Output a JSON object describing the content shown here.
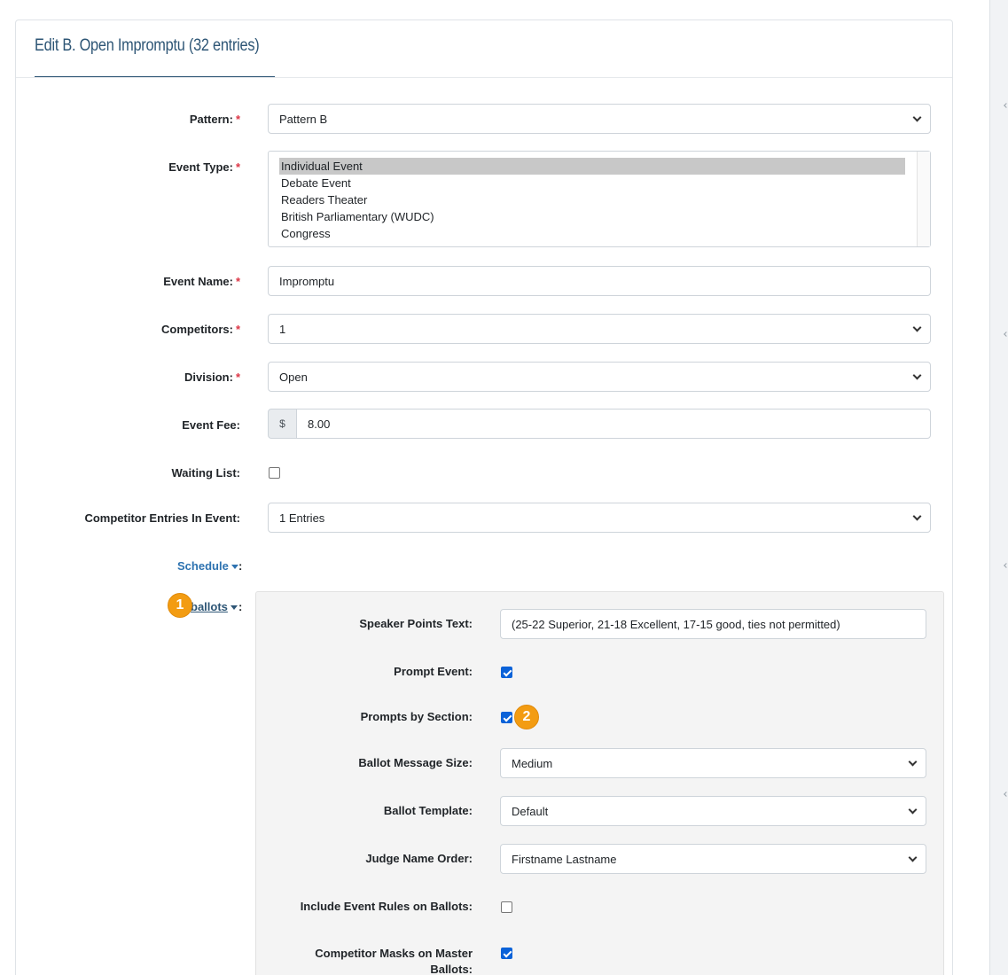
{
  "card": {
    "title": "Edit B. Open Impromptu (32 entries)"
  },
  "required_mark": "*",
  "fields": {
    "pattern": {
      "label": "Pattern:",
      "value": "Pattern B"
    },
    "event_type": {
      "label": "Event Type:",
      "options": [
        "Individual Event",
        "Debate Event",
        "Readers Theater",
        "British Parliamentary (WUDC)",
        "Congress"
      ],
      "selected": "Individual Event"
    },
    "event_name": {
      "label": "Event Name:",
      "value": "Impromptu"
    },
    "competitors": {
      "label": "Competitors:",
      "value": "1"
    },
    "division": {
      "label": "Division:",
      "value": "Open"
    },
    "event_fee": {
      "label": "Event Fee:",
      "currency": "$",
      "value": "8.00"
    },
    "waiting_list": {
      "label": "Waiting List:",
      "checked": false
    },
    "competitor_entries": {
      "label": "Competitor Entries In Event:",
      "value": "1 Entries"
    }
  },
  "schedule": {
    "label": "Schedule",
    "colon": ":"
  },
  "ballots": {
    "label": "ballots",
    "colon": ":",
    "speaker_points": {
      "label": "Speaker Points Text:",
      "value": "(25-22 Superior, 21-18 Excellent, 17-15 good, ties not permitted)"
    },
    "prompt_event": {
      "label": "Prompt Event:",
      "checked": true
    },
    "prompts_by_section": {
      "label": "Prompts by Section:",
      "checked": true
    },
    "ballot_message_size": {
      "label": "Ballot Message Size:",
      "value": "Medium"
    },
    "ballot_template": {
      "label": "Ballot Template:",
      "value": "Default"
    },
    "judge_name_order": {
      "label": "Judge Name Order:",
      "value": "Firstname Lastname"
    },
    "include_event_rules": {
      "label": "Include Event Rules on Ballots:",
      "checked": false
    },
    "competitor_masks": {
      "label_line1": "Competitor Masks on Master",
      "label_line2": "Ballots:",
      "checked": true
    }
  },
  "badges": {
    "one": "1",
    "two": "2"
  },
  "colors": {
    "accent": "#2d5575",
    "link": "#2d72b0",
    "required": "#dc3545",
    "checkbox": "#0b62d8",
    "badge": "#f39c12"
  }
}
